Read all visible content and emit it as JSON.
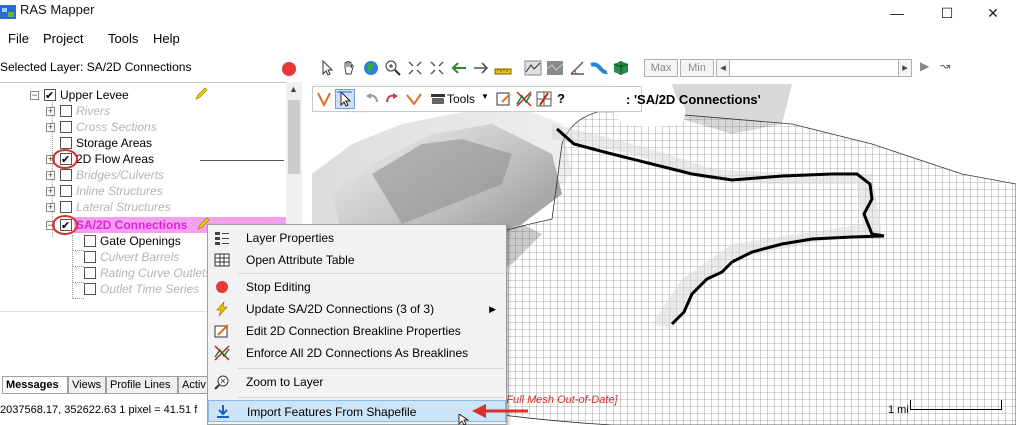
{
  "window": {
    "title": "RAS Mapper",
    "minimize": "—",
    "maximize": "☐",
    "close": "✕"
  },
  "menu": [
    "File",
    "Project",
    "Tools",
    "Help"
  ],
  "left_pane": {
    "selected_layer": "Selected Layer: SA/2D Connections",
    "tree": {
      "root": "Upper Levee",
      "items": [
        {
          "label": "Rivers",
          "checked": false,
          "enabled": false
        },
        {
          "label": "Cross Sections",
          "checked": false,
          "enabled": false
        },
        {
          "label": "Storage Areas",
          "checked": false,
          "enabled": true
        },
        {
          "label": "2D Flow Areas",
          "checked": true,
          "enabled": true
        },
        {
          "label": "Bridges/Culverts",
          "checked": false,
          "enabled": false
        },
        {
          "label": "Inline Structures",
          "checked": false,
          "enabled": false
        },
        {
          "label": "Lateral Structures",
          "checked": false,
          "enabled": false
        },
        {
          "label": "SA/2D Connections",
          "checked": true,
          "enabled": true,
          "selected": true
        }
      ],
      "children": [
        {
          "label": "Gate Openings",
          "enabled": true
        },
        {
          "label": "Culvert Barrels",
          "enabled": false
        },
        {
          "label": "Rating Curve Outlets",
          "enabled": false
        },
        {
          "label": "Outlet Time Series",
          "enabled": false
        }
      ]
    },
    "tabs": [
      "Messages",
      "Views",
      "Profile Lines",
      "Activ"
    ],
    "status": "2037568.17, 352622.63  1 pixel = 41.51 f"
  },
  "toolbar": {
    "max_label": "Max",
    "min_label": "Min",
    "tools_label": "Tools",
    "help_label": "?",
    "active_layer_text": ": 'SA/2D Connections'"
  },
  "map": {
    "warning": "h.]  [Full Mesh Out-of-Date]",
    "scale_label": "1 mi"
  },
  "context_menu": {
    "items": [
      {
        "icon": "layer-properties-icon",
        "label": "Layer Properties"
      },
      {
        "icon": "attribute-table-icon",
        "label": "Open Attribute Table"
      },
      {
        "icon": "stop-editing-icon",
        "label": "Stop Editing"
      },
      {
        "icon": "lightning-icon",
        "label": "Update SA/2D Connections  (3 of 3)"
      },
      {
        "icon": "edit-breakline-icon",
        "label": "Edit 2D Connection Breakline Properties"
      },
      {
        "icon": "enforce-breaklines-icon",
        "label": "Enforce All 2D Connections As Breaklines"
      },
      {
        "icon": "zoom-layer-icon",
        "label": "Zoom to Layer"
      },
      {
        "icon": "import-icon",
        "label": "Import Features From Shapefile"
      }
    ]
  },
  "colors": {
    "selection_pink": "#f5a0ef",
    "selected_text": "#e020e0",
    "annotation_red": "#d9302a",
    "menu_highlight": "#cce4f7"
  }
}
